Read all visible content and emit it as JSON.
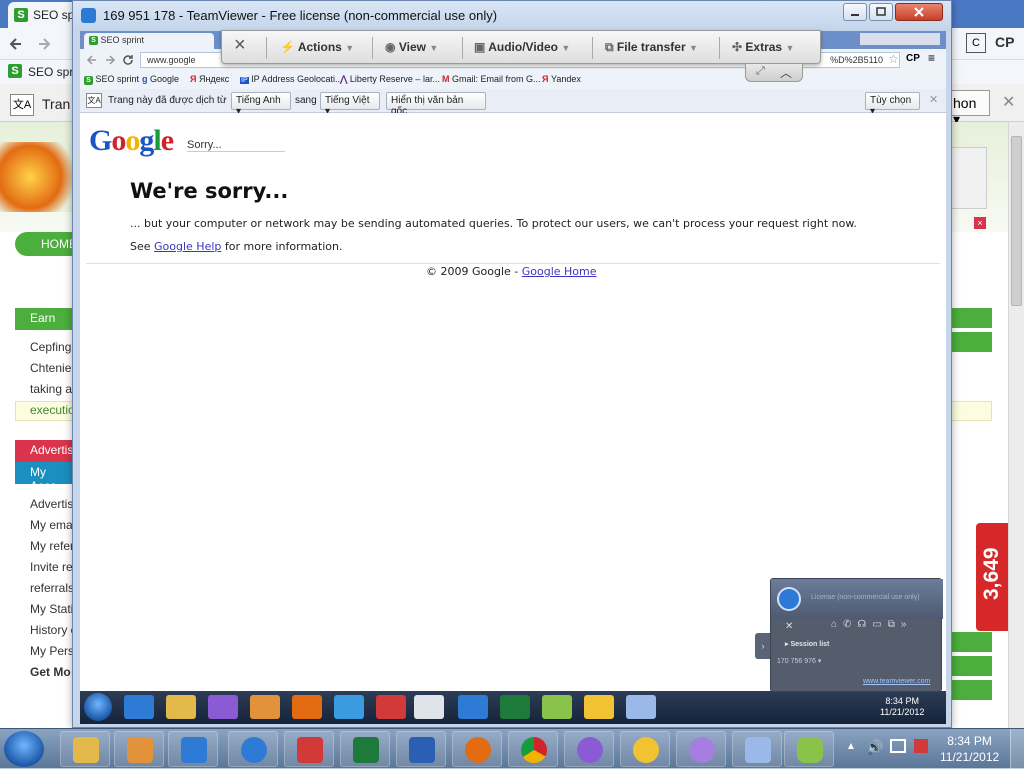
{
  "background_browser": {
    "tab_title": "SEO sp",
    "bookmark_first": "SEO sprin",
    "translate_label": "Tran",
    "translate_select": "hon",
    "left_nav": {
      "home": "HOME",
      "earn_header": "Earn",
      "earn_items": [
        "Cepfing",
        "Chtenie",
        "taking a",
        "executio"
      ],
      "advertise_header": "Advertis",
      "account_header": "My Acco",
      "account_items": [
        "Advertis",
        "My emai",
        "My refer",
        "Invite re",
        "referrals",
        "My Stati",
        "History c",
        "My Perso",
        "Get Mo"
      ]
    },
    "counter": "3,649"
  },
  "teamviewer": {
    "title": "169 951 178 - TeamViewer - Free license (non-commercial use only)",
    "toolbar": {
      "close": "×",
      "actions": "Actions",
      "view": "View",
      "audio_video": "Audio/Video",
      "file_transfer": "File transfer",
      "extras": "Extras"
    },
    "panel": {
      "title": "License (non-commercial use only)",
      "session_list": "Session list",
      "session_id": "170 756 976",
      "link": "www.teamviewer.com"
    }
  },
  "remote_browser": {
    "tab_title": "SEO sprint",
    "url": "www.google",
    "url_tail": "%D%2B5110",
    "bookmarks": [
      "SEO sprint",
      "Google",
      "Яндекс",
      "IP Address Geolocati...",
      "Liberty Reserve – lar...",
      "Gmail: Email from G...",
      "Yandex"
    ],
    "translate": {
      "prefix": "Trang này đã được dịch từ",
      "from": "Tiếng Anh",
      "middle": "sang",
      "to": "Tiếng Việt",
      "show_original": "Hiển thị văn bản gốc",
      "options": "Tùy chọn"
    }
  },
  "google_sorry": {
    "logo": [
      "G",
      "o",
      "o",
      "g",
      "l",
      "e"
    ],
    "small_title": "Sorry...",
    "heading": "We're sorry...",
    "message": "... but your computer or network may be sending automated queries. To protect our users, we can't process your request right now.",
    "help_prefix": "See ",
    "help_link": "Google Help",
    "help_suffix": " for more information.",
    "footer_prefix": "© 2009 Google - ",
    "footer_link": "Google Home"
  },
  "remote_taskbar": {
    "time": "8:34 PM",
    "date": "11/21/2012"
  },
  "taskbar": {
    "time": "8:34 PM",
    "date": "11/21/2012"
  },
  "colors": {
    "accent_green": "#4cae3c",
    "badge_red": "#d62828",
    "google_link": "#3a36c0"
  }
}
